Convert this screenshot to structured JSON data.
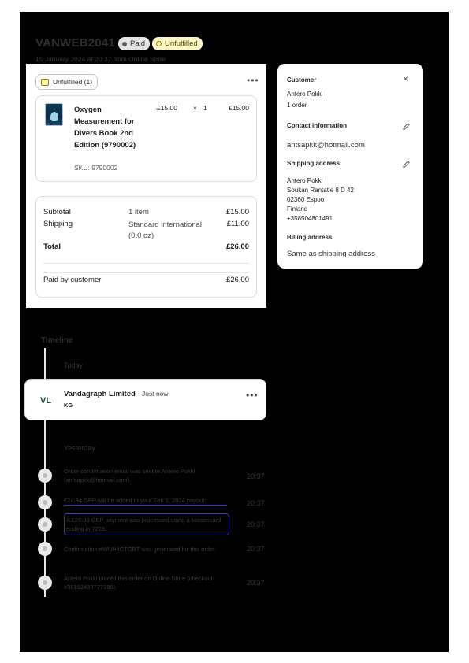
{
  "header": {
    "order_id": "VANWEB2041",
    "paid_badge": "Paid",
    "fulfillment_badge": "Unfulfilled",
    "subtitle": "15 January 2024 at 20:37 from Online Store"
  },
  "order": {
    "fulfillment_chip": "Unfulfilled (1)",
    "more_label": "•••",
    "item": {
      "title": "Oxygen Measurement for Divers Book 2nd Edition (9790002)",
      "sku": "SKU: 9790002",
      "unit_price": "£15.00",
      "times": "×",
      "quantity": "1",
      "line_total": "£15.00"
    },
    "summary": {
      "subtotal_label": "Subtotal",
      "subtotal_items": "1 item",
      "subtotal_value": "£15.00",
      "shipping_label": "Shipping",
      "shipping_method": "Standard international (0.0 oz)",
      "shipping_value": "£11.00",
      "total_label": "Total",
      "total_value": "£26.00",
      "paid_label": "Paid by customer",
      "paid_value": "£26.00"
    }
  },
  "customer": {
    "heading": "Customer",
    "close_label": "×",
    "name": "Antero Pokki",
    "orders": "1 order",
    "contact_heading": "Contact information",
    "email": "antsapkk@hotmail.com",
    "shipping_heading": "Shipping address",
    "address_lines": [
      "Antero Pokki",
      "Soukan Rantatie 8 D 42",
      "02360 Espoo",
      "Finland",
      "+358504801491"
    ],
    "billing_heading": "Billing address",
    "billing_value": "Same as shipping address"
  },
  "timeline": {
    "title": "Timeline",
    "today_label": "Today",
    "comment": {
      "avatar": "VL",
      "author": "Vandagraph Limited",
      "time": "Just now",
      "text": "KG",
      "more_label": "•••"
    },
    "yesterday_label": "Yesterday",
    "events": [
      {
        "text": "Order confirmation email was sent to Antero Pokki (antsapkk@hotmail.com).",
        "time": "20:37"
      },
      {
        "text": "€24.94 GBP will be added to your Feb 1, 2024 payout.",
        "time": "20:37"
      },
      {
        "text": "A £26.00 GBP payment was processed using a Mastercard ending in 7728.",
        "time": "20:37"
      },
      {
        "text": "Confirmation #WNH4CTGBT was generated for this order.",
        "time": "20:37"
      },
      {
        "text": "Antero Pokki placed this order on Online Store (checkout #36192436777185).",
        "time": "20:37"
      }
    ]
  },
  "colors": {
    "backdrop": "#000000",
    "paid_badge_bg": "#e4e4e4",
    "unfulfilled_badge_bg": "#fff7c5",
    "avatar_text": "#164f2a",
    "selection_border": "#2e3fa6"
  }
}
